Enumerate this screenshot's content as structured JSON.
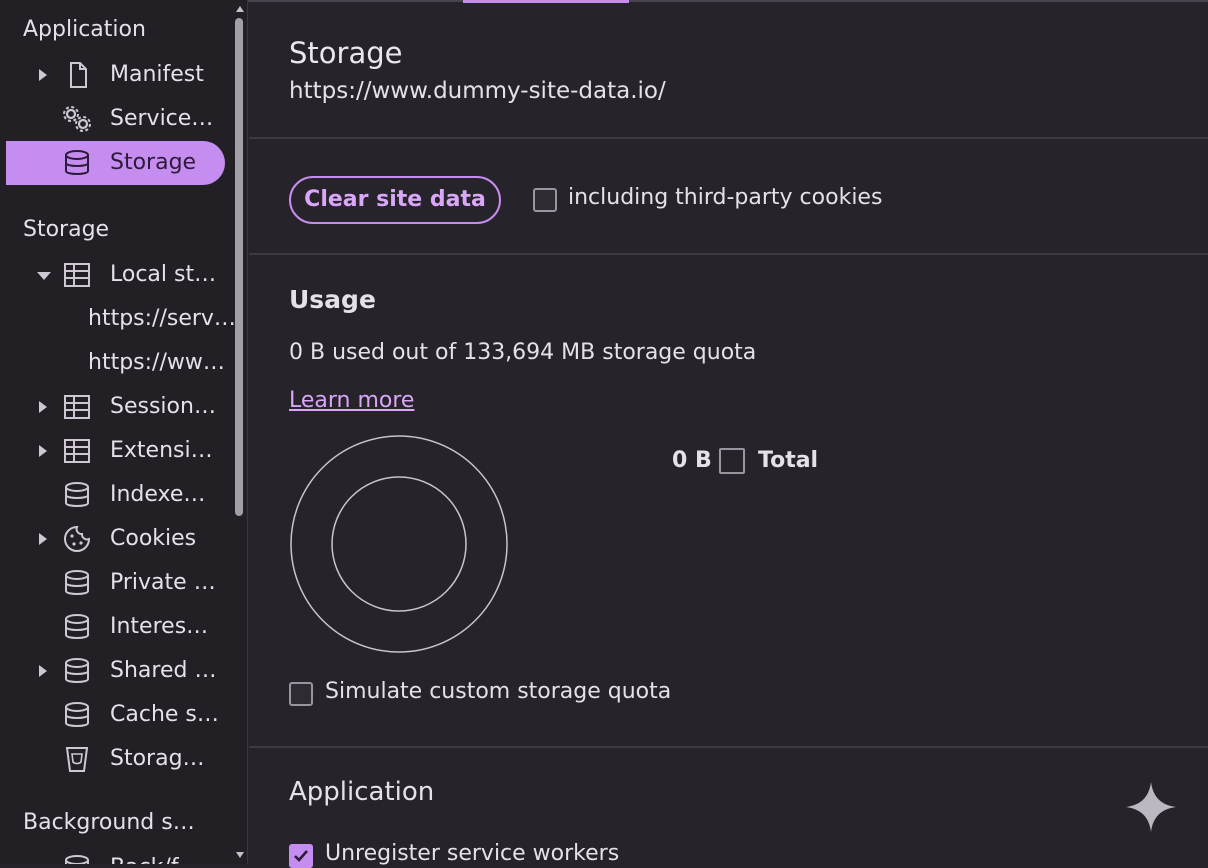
{
  "sidebar": {
    "section_application": "Application",
    "section_storage": "Storage",
    "section_background": "Background s…",
    "app_items": [
      {
        "label": "Manifest"
      },
      {
        "label": "Service…"
      },
      {
        "label": "Storage"
      }
    ],
    "storage_items": [
      {
        "label": "Local st…"
      },
      {
        "label": "https://serv…"
      },
      {
        "label": "https://ww…"
      },
      {
        "label": "Session…"
      },
      {
        "label": "Extensi…"
      },
      {
        "label": "Indexe…"
      },
      {
        "label": "Cookies"
      },
      {
        "label": "Private …"
      },
      {
        "label": "Interes…"
      },
      {
        "label": "Shared …"
      },
      {
        "label": "Cache s…"
      },
      {
        "label": "Storag…"
      }
    ],
    "background_items": [
      {
        "label": "Back/f…"
      }
    ]
  },
  "main": {
    "title": "Storage",
    "origin": "https://www.dummy-site-data.io/",
    "clear_button": "Clear site data",
    "third_party_label": "including third-party cookies",
    "third_party_checked": false,
    "usage_heading": "Usage",
    "usage_text": "0 B used out of 133,694 MB storage quota",
    "learn_more": "Learn more",
    "legend": {
      "value": "0 B",
      "label": "Total"
    },
    "simulate_label": "Simulate custom storage quota",
    "simulate_checked": false,
    "application_heading": "Application",
    "unregister_label": "Unregister service workers",
    "unregister_checked": true
  },
  "colors": {
    "accent": "#c68df0",
    "background": "#27232a",
    "sidebar_background": "#221f25",
    "text": "#e6e0e9"
  },
  "icons": {
    "manifest": "document-icon",
    "service_workers": "gears-icon",
    "storage": "database-icon",
    "local_storage": "table-icon",
    "cookies": "cookie-icon",
    "storage_buckets": "bucket-icon",
    "assistant": "sparkle-icon"
  }
}
